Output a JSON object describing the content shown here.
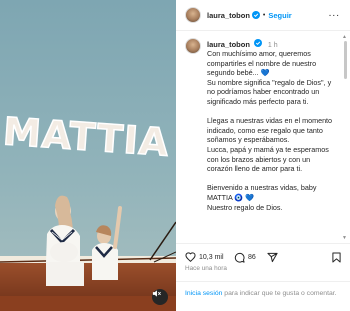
{
  "post": {
    "username": "laura_tobon",
    "follow_label": "Seguir",
    "dot": "•",
    "more_label": "...",
    "time": "1 h"
  },
  "caption": {
    "lines": [
      "Con muchísimo amor, queremos",
      "compartirles el nombre de nuestro",
      "segundo bebé... 💙",
      "Su nombre significa \"regalo de Dios\", y",
      "no podríamos haber encontrado un",
      "significado más perfecto para ti.",
      "",
      "Llegas a nuestras vidas en el momento",
      "indicado, como ese regalo que tanto",
      "soñamos y esperábamos.",
      "Lucca, papá y mamá ya te esperamos",
      "con los brazos abiertos y con un",
      "corazón lleno de amor para ti.",
      "",
      "Bienvenido a nuestras vidas, baby",
      "MATTIA 🧿 💙",
      "Nuestro regalo de Dios."
    ]
  },
  "media": {
    "name_on_image": "MATTIA"
  },
  "actions": {
    "likes": "10,3 mil",
    "comments": "86",
    "time_ago": "Hace una hora"
  },
  "footer": {
    "login_link": "Inicia sesión",
    "rest": " para indicar que te gusta o comentar."
  },
  "colors": {
    "accent": "#0095f6",
    "text": "#262626",
    "muted": "#8e8e8e",
    "sky": "#8db0b8"
  },
  "icons": [
    "verified-badge-icon",
    "more-options-icon",
    "heart-icon",
    "comment-icon",
    "share-icon",
    "save-icon",
    "add-comment-icon",
    "volume-off-icon"
  ]
}
